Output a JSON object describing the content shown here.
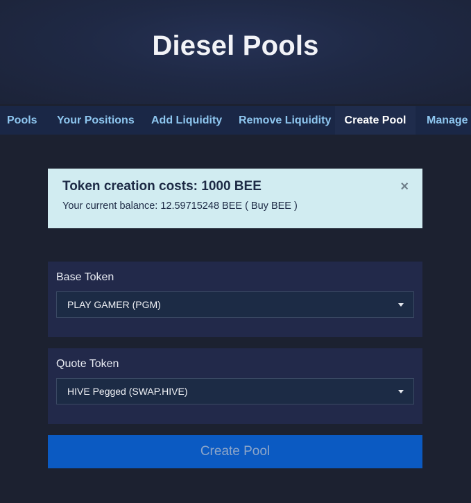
{
  "header": {
    "title": "Diesel Pools"
  },
  "nav": {
    "items": [
      {
        "label": "Pools"
      },
      {
        "label": "Your Positions"
      },
      {
        "label": "Add Liquidity"
      },
      {
        "label": "Remove Liquidity"
      },
      {
        "label": "Create Pool"
      },
      {
        "label": "Manage I"
      }
    ],
    "active": "Create Pool"
  },
  "alert": {
    "title": "Token creation costs: 1000 BEE",
    "balance_text": "Your current balance: 12.59715248 BEE ( Buy BEE )",
    "close_symbol": "×"
  },
  "form": {
    "base_token": {
      "label": "Base Token",
      "selected": "PLAY GAMER (PGM)"
    },
    "quote_token": {
      "label": "Quote Token",
      "selected": "HIVE Pegged (SWAP.HIVE)"
    },
    "submit_label": "Create Pool"
  },
  "colors": {
    "background": "#1c2130",
    "nav_background": "#1a2746",
    "nav_link": "#8ec6ef",
    "alert_background": "#d1ecf1",
    "card_background": "#22294a",
    "button_background": "#0b5ac2"
  },
  "icons": {
    "alert_close": "close-icon",
    "select_caret": "chevron-down-icon"
  }
}
